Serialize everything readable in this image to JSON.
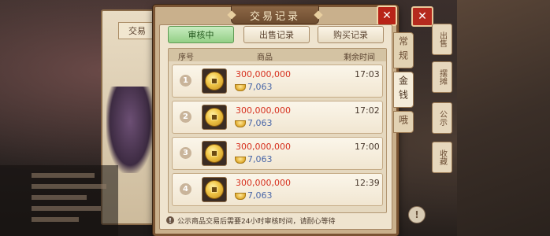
{
  "background": {
    "left_tab_label": "交易",
    "right_side_tabs": [
      "出售",
      "摆摊",
      "公示",
      "收藏"
    ],
    "close_symbol": "✕",
    "info_symbol": "!"
  },
  "dialog": {
    "title": "交易记录",
    "close_symbol": "✕",
    "tabs": [
      {
        "label": "审核中",
        "active": true
      },
      {
        "label": "出售记录",
        "active": false
      },
      {
        "label": "购买记录",
        "active": false
      }
    ],
    "side_tabs": [
      {
        "label": "常规",
        "active": false
      },
      {
        "label": "金钱",
        "active": true
      },
      {
        "label": "哦",
        "active": false
      }
    ],
    "columns": {
      "index": "序号",
      "item": "商品",
      "remaining": "剩余时间"
    },
    "rows": [
      {
        "index": "1",
        "amount": "300,000,000",
        "price": "7,063",
        "time": "17:03"
      },
      {
        "index": "2",
        "amount": "300,000,000",
        "price": "7,063",
        "time": "17:02"
      },
      {
        "index": "3",
        "amount": "300,000,000",
        "price": "7,063",
        "time": "17:00"
      },
      {
        "index": "4",
        "amount": "300,000,000",
        "price": "7,063",
        "time": "12:39"
      }
    ],
    "notice_icon": "!",
    "notice": "公示商品交易后需要24小时审核时间，请耐心等待"
  },
  "colors": {
    "active_tab": "#93cf86",
    "amount": "#d6301e",
    "price": "#4a67a8",
    "close": "#b82318"
  }
}
